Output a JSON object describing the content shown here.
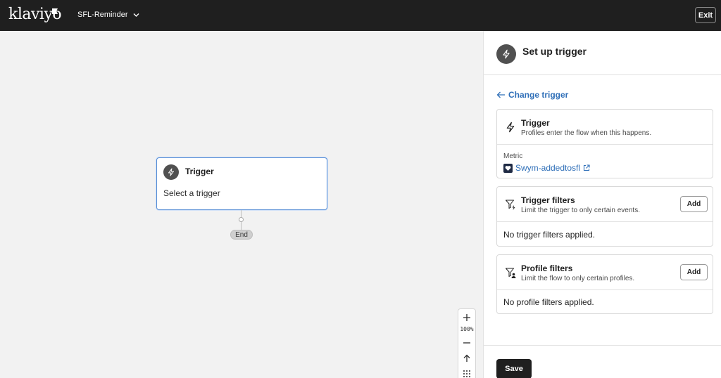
{
  "topbar": {
    "logo": "klaviyo",
    "flow_name": "SFL-Reminder",
    "exit_label": "Exit"
  },
  "canvas": {
    "trigger_node": {
      "title": "Trigger",
      "subtitle": "Select a trigger"
    },
    "end_label": "End",
    "zoom": {
      "level": "100%"
    }
  },
  "panel": {
    "title": "Set up trigger",
    "change_trigger": "Change trigger",
    "trigger_card": {
      "title": "Trigger",
      "description": "Profiles enter the flow when this happens.",
      "metric_label": "Metric",
      "metric_value": "Swym-addedtosfl"
    },
    "trigger_filters": {
      "title": "Trigger filters",
      "description": "Limit the trigger to only certain events.",
      "add_label": "Add",
      "empty": "No trigger filters applied."
    },
    "profile_filters": {
      "title": "Profile filters",
      "description": "Limit the flow to only certain profiles.",
      "add_label": "Add",
      "empty": "No profile filters applied."
    },
    "save_label": "Save"
  }
}
